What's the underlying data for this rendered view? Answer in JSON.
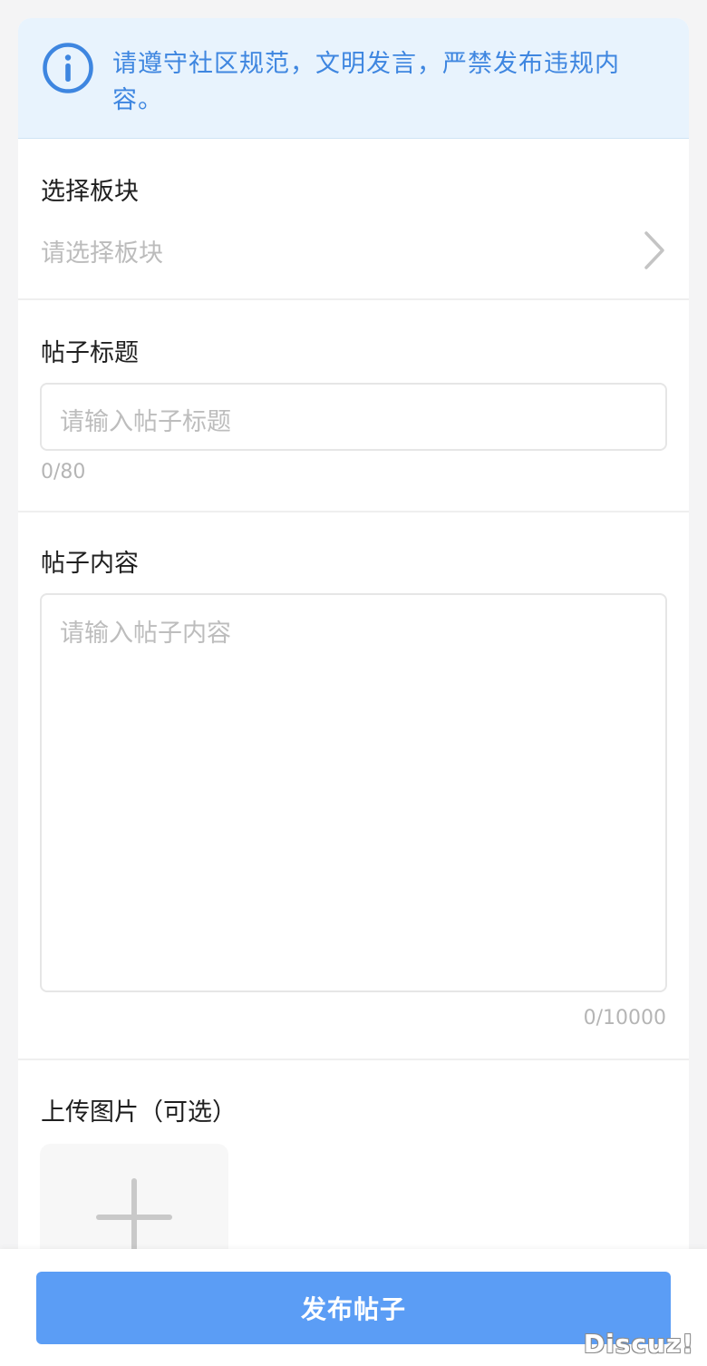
{
  "notice": {
    "text": "请遵守社区规范，文明发言，严禁发布违规内容。",
    "icon": "info-circle-icon",
    "color": "#3e86e0"
  },
  "board": {
    "label": "选择板块",
    "placeholder": "请选择板块",
    "icon": "chevron-right-icon"
  },
  "title": {
    "label": "帖子标题",
    "placeholder": "请输入帖子标题",
    "counter": "0/80"
  },
  "content": {
    "label": "帖子内容",
    "placeholder": "请输入帖子内容",
    "counter": "0/10000"
  },
  "upload": {
    "label": "上传图片（可选）",
    "icon": "plus-icon"
  },
  "footer": {
    "publish_label": "发布帖子",
    "accent": "#5b9df5"
  },
  "watermark": "Discuz!"
}
